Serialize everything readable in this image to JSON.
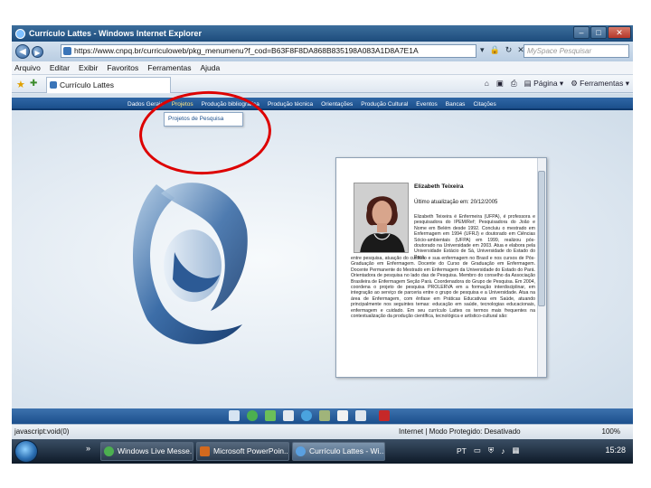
{
  "window": {
    "title": "Currículo Lattes - Windows Internet Explorer"
  },
  "address": {
    "url": "https://www.cnpq.br/curriculoweb/pkg_menumenu?f_cod=B63F8F8DA868B835198A083A1D8A7E1A",
    "search_placeholder": "MySpace Pesquisar"
  },
  "menubar": {
    "items": [
      "Arquivo",
      "Editar",
      "Exibir",
      "Favoritos",
      "Ferramentas",
      "Ajuda"
    ]
  },
  "favbar": {
    "tab_label": "Currículo Lattes",
    "cmd_page": "Página",
    "cmd_tools": "Ferramentas"
  },
  "lattes": {
    "nav": [
      "Dados Gerais",
      "Projetos",
      "Produção bibliográfica",
      "Produção técnica",
      "Orientações",
      "Produção Cultural",
      "Eventos",
      "Bancas",
      "Citações"
    ],
    "dropdown_item": "Projetos de Pesquisa"
  },
  "profile": {
    "name": "Elizabeth Teixeira",
    "updated": "Último atualização em: 20/12/2005",
    "bio_short": "Elizabeth Teixeira é Enfermeira (UFPA), é professora e pesquisadora do IPEM/Ref; Pesquisadora do João e Nome em Belém desde 1992. Concluiu o mestrado em Enfermagem em 1994 (UFRJ) e doutorado em Ciências Sócio-ambientais (UFPA) em 1999, realizou pós-doutorado na Universidade em 2003. Atua e elabora pela Universidade Estácio de Sá, Universidade do Estado do Pará,",
    "bio_long": "entre pesquisa, atuação do cuidado e sua enfermagem no Brasil e nos cursos de Pós-Graduação em Enfermagem. Docente do Curso de Graduação em Enfermagem. Docente Permanente do Mestrado em Enfermagem da Universidade do Estado do Pará. Orientadora de pesquisa no lado das de Pesquisa. Membro do conselho da Associação Brasileira de Enfermagem Seção Pará. Coordenadora do Grupo de Pesquisa. Em 2004, coordena o projeto de pesquisa PROLERVA em a formação interdisciplinar, em integração ao serviço de parceria entre o grupo de pesquisa e a Universidade. Atua na área de Enfermagem, com ênfase em Práticas Educativas em Saúde, atuando principalmente nos seguintes temas: educação em saúde, tecnologias educacionais, enfermagem e cuidado. Em seu currículo Lattes os termos mais frequentes na contextualização da produção científica, tecnológica e artístico-cultural são:"
  },
  "status": {
    "left": "javascript:void(0)",
    "zone": "Internet | Modo Protegido: Desativado",
    "zoom": "100%"
  },
  "taskbar": {
    "quick": "»",
    "buttons": [
      "Windows Live Messe...",
      "Microsoft PowerPoin...",
      "Currículo Lattes - Wi..."
    ],
    "lang": "PT",
    "time": "15:28"
  },
  "colors": {
    "nav_blue": "#1b4f8c",
    "annotation_red": "#d00000"
  }
}
